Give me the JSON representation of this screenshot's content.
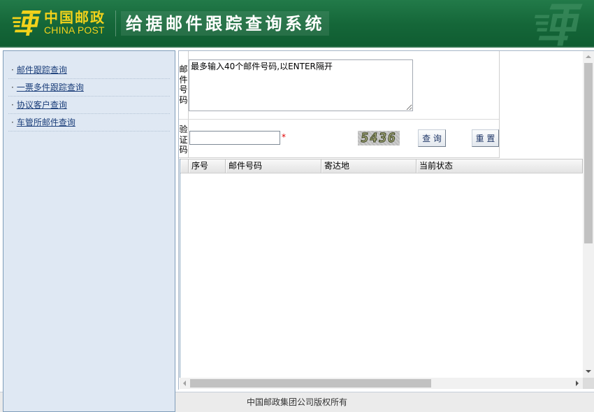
{
  "header": {
    "logo_cn": "中国邮政",
    "logo_en": "CHINA POST",
    "title": "给据邮件跟踪查询系统",
    "logo_icon": "china-post-logo-icon",
    "watermark_icon": "china-post-watermark-icon"
  },
  "sidebar": {
    "bullet": "·",
    "items": [
      {
        "label": "邮件跟踪查询"
      },
      {
        "label": "一票多件跟踪查询"
      },
      {
        "label": "协议客户查询"
      },
      {
        "label": "车管所邮件查询"
      }
    ]
  },
  "query_form": {
    "mail_number_label": "邮件号码",
    "mail_number_value": "最多输入40个邮件号码,以ENTER隔开",
    "captcha_label": "验证码",
    "captcha_value": "",
    "required_mark": "*",
    "captcha_image_text": "5436",
    "query_button": "查 询",
    "reset_button": "重 置"
  },
  "results_table": {
    "columns": [
      "序号",
      "邮件号码",
      "寄达地",
      "当前状态"
    ],
    "rows": []
  },
  "footer": {
    "copyright": "中国邮政集团公司版权所有"
  },
  "colors": {
    "header_green": "#156739",
    "logo_yellow": "#f2d21b",
    "watermark_green": "#3e8e60",
    "sidebar_bg": "#dfe8f3",
    "sidebar_border": "#7f9db9",
    "link_blue": "#1b3e7a",
    "required_red": "#e00000",
    "footer_bg": "#ebebeb"
  }
}
